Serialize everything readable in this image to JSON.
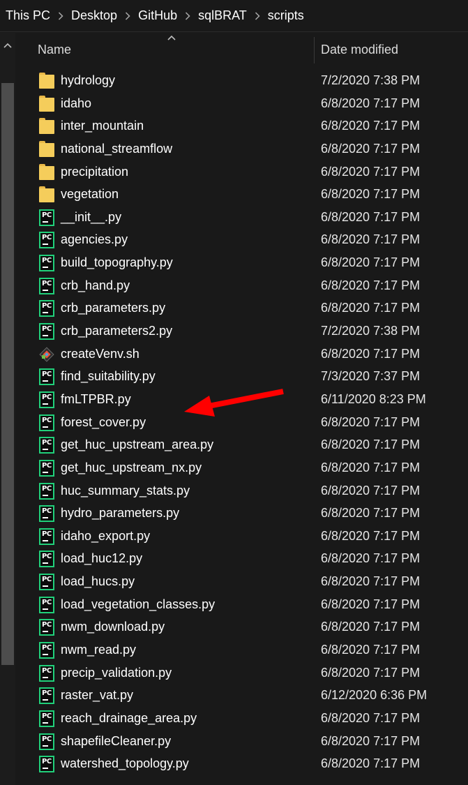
{
  "breadcrumb": [
    "This PC",
    "Desktop",
    "GitHub",
    "sqlBRAT",
    "scripts"
  ],
  "columns": {
    "name": "Name",
    "date_modified": "Date modified"
  },
  "files": [
    {
      "name": "hydrology",
      "date": "7/2/2020 7:38 PM",
      "icon": "folder-icon"
    },
    {
      "name": "idaho",
      "date": "6/8/2020 7:17 PM",
      "icon": "folder-icon"
    },
    {
      "name": "inter_mountain",
      "date": "6/8/2020 7:17 PM",
      "icon": "folder-icon"
    },
    {
      "name": "national_streamflow",
      "date": "6/8/2020 7:17 PM",
      "icon": "folder-icon"
    },
    {
      "name": "precipitation",
      "date": "6/8/2020 7:17 PM",
      "icon": "folder-icon"
    },
    {
      "name": "vegetation",
      "date": "6/8/2020 7:17 PM",
      "icon": "folder-icon"
    },
    {
      "name": "__init__.py",
      "date": "6/8/2020 7:17 PM",
      "icon": "pycharm-file-icon"
    },
    {
      "name": "agencies.py",
      "date": "6/8/2020 7:17 PM",
      "icon": "pycharm-file-icon"
    },
    {
      "name": "build_topography.py",
      "date": "6/8/2020 7:17 PM",
      "icon": "pycharm-file-icon"
    },
    {
      "name": "crb_hand.py",
      "date": "6/8/2020 7:17 PM",
      "icon": "pycharm-file-icon"
    },
    {
      "name": "crb_parameters.py",
      "date": "6/8/2020 7:17 PM",
      "icon": "pycharm-file-icon"
    },
    {
      "name": "crb_parameters2.py",
      "date": "7/2/2020 7:38 PM",
      "icon": "pycharm-file-icon"
    },
    {
      "name": "createVenv.sh",
      "date": "6/8/2020 7:17 PM",
      "icon": "git-bash-icon"
    },
    {
      "name": "find_suitability.py",
      "date": "7/3/2020 7:37 PM",
      "icon": "pycharm-file-icon"
    },
    {
      "name": "fmLTPBR.py",
      "date": "6/11/2020 8:23 PM",
      "icon": "pycharm-file-icon"
    },
    {
      "name": "forest_cover.py",
      "date": "6/8/2020 7:17 PM",
      "icon": "pycharm-file-icon"
    },
    {
      "name": "get_huc_upstream_area.py",
      "date": "6/8/2020 7:17 PM",
      "icon": "pycharm-file-icon"
    },
    {
      "name": "get_huc_upstream_nx.py",
      "date": "6/8/2020 7:17 PM",
      "icon": "pycharm-file-icon"
    },
    {
      "name": "huc_summary_stats.py",
      "date": "6/8/2020 7:17 PM",
      "icon": "pycharm-file-icon"
    },
    {
      "name": "hydro_parameters.py",
      "date": "6/8/2020 7:17 PM",
      "icon": "pycharm-file-icon"
    },
    {
      "name": "idaho_export.py",
      "date": "6/8/2020 7:17 PM",
      "icon": "pycharm-file-icon"
    },
    {
      "name": "load_huc12.py",
      "date": "6/8/2020 7:17 PM",
      "icon": "pycharm-file-icon"
    },
    {
      "name": "load_hucs.py",
      "date": "6/8/2020 7:17 PM",
      "icon": "pycharm-file-icon"
    },
    {
      "name": "load_vegetation_classes.py",
      "date": "6/8/2020 7:17 PM",
      "icon": "pycharm-file-icon"
    },
    {
      "name": "nwm_download.py",
      "date": "6/8/2020 7:17 PM",
      "icon": "pycharm-file-icon"
    },
    {
      "name": "nwm_read.py",
      "date": "6/8/2020 7:17 PM",
      "icon": "pycharm-file-icon"
    },
    {
      "name": "precip_validation.py",
      "date": "6/8/2020 7:17 PM",
      "icon": "pycharm-file-icon"
    },
    {
      "name": "raster_vat.py",
      "date": "6/12/2020 6:36 PM",
      "icon": "pycharm-file-icon"
    },
    {
      "name": "reach_drainage_area.py",
      "date": "6/8/2020 7:17 PM",
      "icon": "pycharm-file-icon"
    },
    {
      "name": "shapefileCleaner.py",
      "date": "6/8/2020 7:17 PM",
      "icon": "pycharm-file-icon"
    },
    {
      "name": "watershed_topology.py",
      "date": "6/8/2020 7:17 PM",
      "icon": "pycharm-file-icon"
    }
  ],
  "icon_labels": {
    "pycharm": "PC"
  },
  "colors": {
    "background": "#191919",
    "folder": "#f5cd5b",
    "pycharm_border": "#21d07a",
    "annotation_arrow": "#ff0000"
  }
}
